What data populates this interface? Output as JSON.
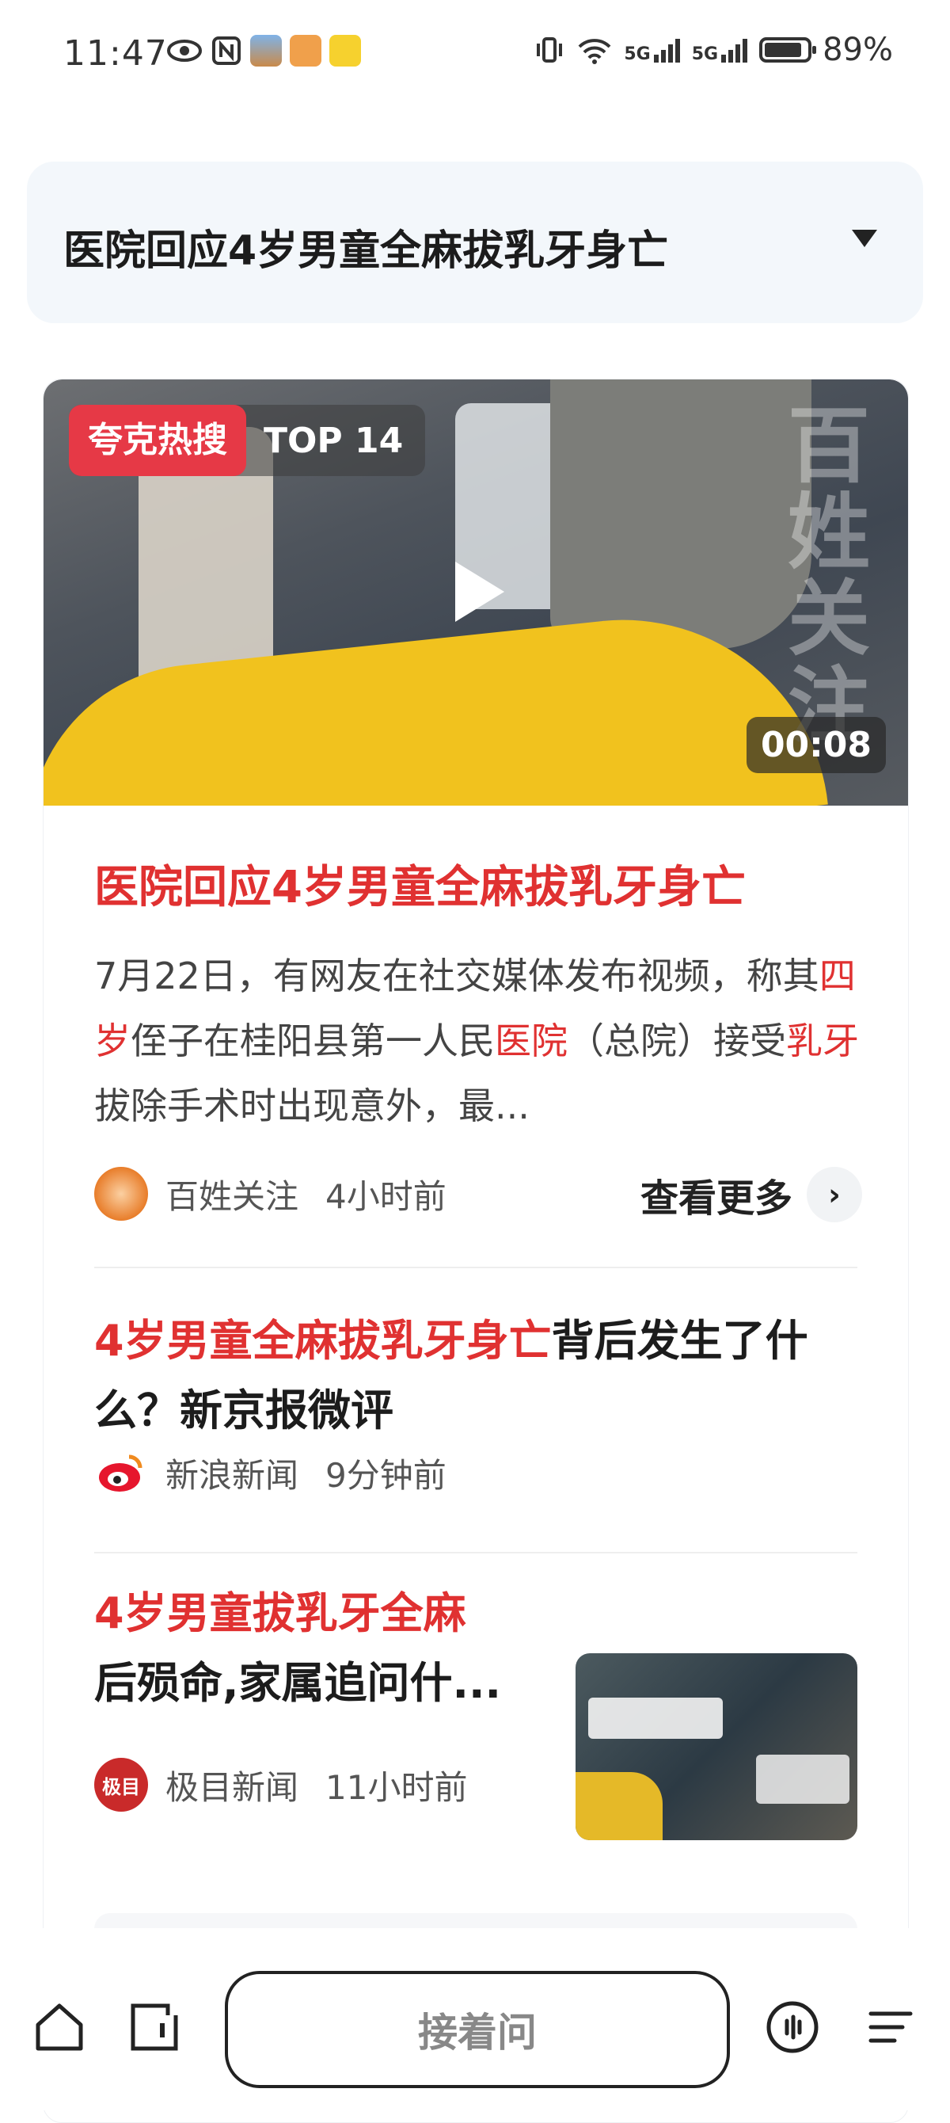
{
  "status_bar": {
    "time": "11:47",
    "network_5g_1": "5G",
    "network_5g_2": "5G",
    "battery_percent": "89%",
    "battery_level": 0.89
  },
  "query": {
    "text": "医院回应4岁男童全麻拔乳牙身亡"
  },
  "video": {
    "brand": "夸克热搜",
    "rank": "TOP 14",
    "watermark": "百姓关注",
    "duration": "00:08",
    "accent_color": "#e63946"
  },
  "lead": {
    "title": "医院回应4岁男童全麻拔乳牙身亡",
    "summary_parts": [
      {
        "text": "7月22日，有网友在社交媒体发布视频，称其",
        "hl": false
      },
      {
        "text": "四岁",
        "hl": true
      },
      {
        "text": "侄子在桂阳县第一人民",
        "hl": false
      },
      {
        "text": "医院",
        "hl": true
      },
      {
        "text": "（总院）接受",
        "hl": false
      },
      {
        "text": "乳牙",
        "hl": true
      },
      {
        "text": "拔除手术时出现意外，最...",
        "hl": false
      }
    ],
    "source": "百姓关注",
    "time": "4小时前",
    "more_label": "查看更多"
  },
  "items": [
    {
      "title_hl": "4岁男童全麻拔乳牙身亡",
      "title_rest": "背后发生了什么？新京报微评",
      "source": "新浪新闻",
      "time": "9分钟前"
    },
    {
      "title_hl": "4岁男童拔乳牙全麻",
      "title_rest": "后殒命,家属追问什...",
      "source": "极目新闻",
      "source_logo_text": "极目",
      "time": "11小时前"
    }
  ],
  "bottom_bar": {
    "ask_label": "接着问"
  },
  "colors": {
    "highlight": "#e03131"
  }
}
